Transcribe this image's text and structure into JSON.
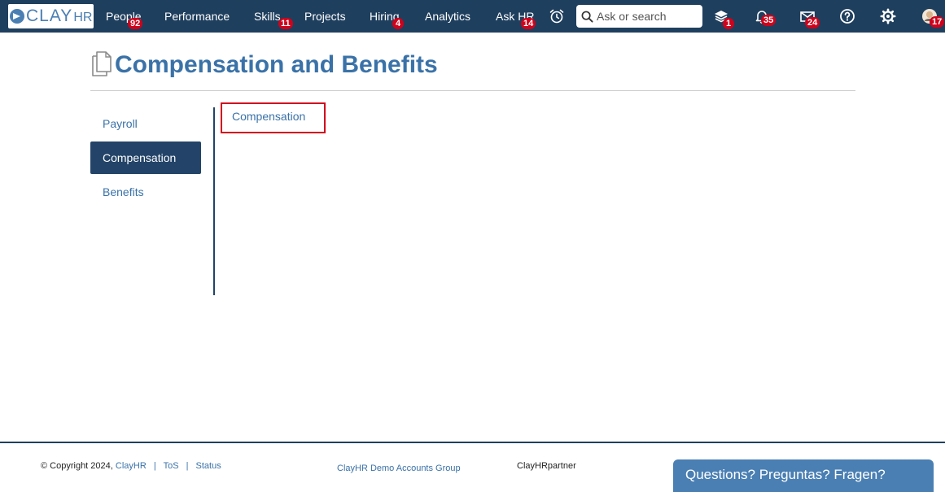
{
  "app": {
    "logo_text": "CLAY",
    "logo_suffix": "HR"
  },
  "nav": {
    "items": [
      {
        "label": "People",
        "badge": "92"
      },
      {
        "label": "Performance",
        "badge": ""
      },
      {
        "label": "Skills",
        "badge": "11"
      },
      {
        "label": "Projects",
        "badge": ""
      },
      {
        "label": "Hiring",
        "badge": "4"
      },
      {
        "label": "Analytics",
        "badge": ""
      },
      {
        "label": "Ask HR",
        "badge": "14"
      }
    ],
    "search_placeholder": "Ask or search",
    "icons": {
      "timer": {
        "icon": "alarm-clock-icon",
        "badge": ""
      },
      "learning": {
        "icon": "stack-layers-icon",
        "badge": "1"
      },
      "notifications": {
        "icon": "bell-icon",
        "badge": "35"
      },
      "messages": {
        "icon": "envelope-icon",
        "badge": "24"
      },
      "help": {
        "icon": "question-icon",
        "badge": ""
      },
      "settings": {
        "icon": "gear-icon",
        "badge": ""
      },
      "profile": {
        "icon": "avatar-icon",
        "badge": "17"
      }
    },
    "background": "#1f3f5e",
    "badge_color": "#d0021b"
  },
  "page": {
    "title": "Compensation and Benefits"
  },
  "sidebar": {
    "items": [
      {
        "label": "Payroll",
        "active": false
      },
      {
        "label": "Compensation",
        "active": true
      },
      {
        "label": "Benefits",
        "active": false
      }
    ],
    "active_color": "#234468"
  },
  "content": {
    "subtab_label": "Compensation"
  },
  "footer": {
    "copyright": "© Copyright 2024,",
    "company_link": "ClayHR",
    "tos_link": "ToS",
    "status_link": "Status",
    "group_link": "ClayHR Demo Accounts Group",
    "partner": "ClayHRpartner",
    "chat_label": "Questions? Preguntas? Fragen?"
  }
}
